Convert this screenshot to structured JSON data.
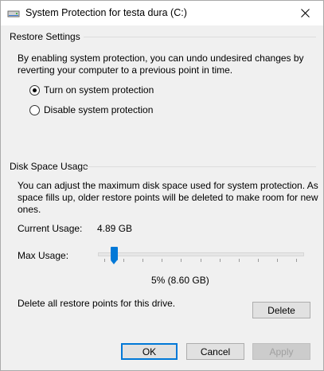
{
  "window": {
    "title": "System Protection for testa dura (C:)",
    "close_glyph": "✕"
  },
  "restore": {
    "heading": "Restore Settings",
    "description_line1": "By enabling system protection, you can undo undesired changes by",
    "description_line2": "reverting your computer to a previous point in time.",
    "options": [
      {
        "label": "Turn on system protection",
        "selected": true
      },
      {
        "label": "Disable system protection",
        "selected": false
      }
    ]
  },
  "disk": {
    "heading": "Disk Space Usage",
    "description_line1": "You can adjust the maximum disk space used for system protection. As",
    "description_line2": "space fills up, older restore points will be deleted to make room for new",
    "description_line3": "ones.",
    "current_usage_label": "Current Usage:",
    "current_usage_value": "4.89 GB",
    "max_usage_label": "Max Usage:",
    "max_usage_percent": 5,
    "max_usage_readout": "5% (8.60 GB)",
    "delete_text": "Delete all restore points for this drive.",
    "delete_button": "Delete"
  },
  "footer": {
    "ok": "OK",
    "cancel": "Cancel",
    "apply": "Apply"
  },
  "colors": {
    "accent": "#0078d7",
    "dialog_bg": "#f0f0f0"
  }
}
